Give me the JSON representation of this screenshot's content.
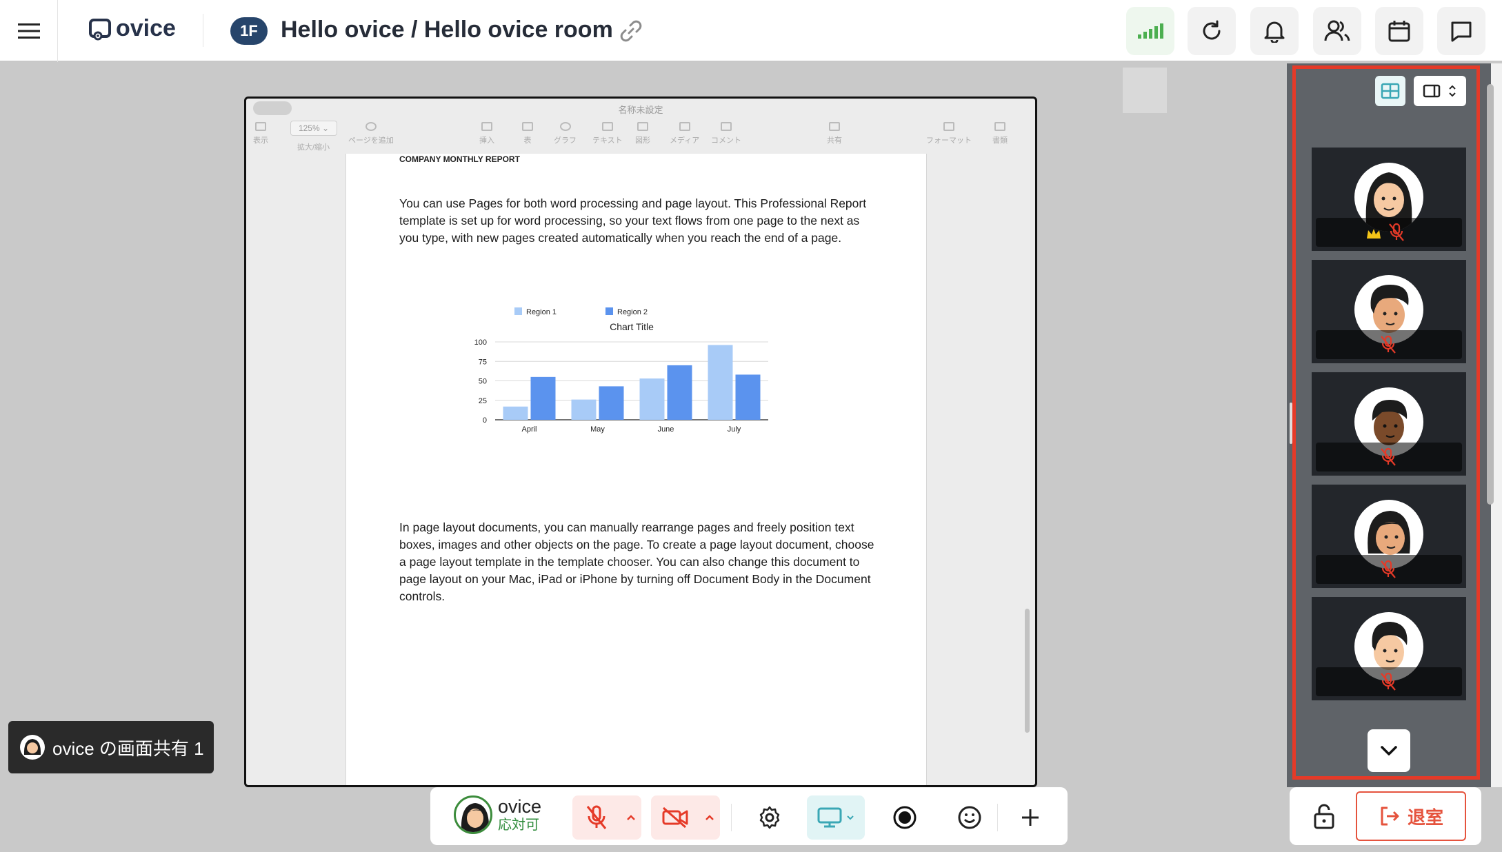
{
  "app": {
    "logo_text": "ovice",
    "floor_badge": "1F",
    "room_title": "Hello ovice / Hello ovice room"
  },
  "top_actions": [
    "signal-icon",
    "refresh-icon",
    "bell-icon",
    "users-icon",
    "calendar-icon",
    "chat-icon"
  ],
  "colors": {
    "accent_teal": "#3aa7b5",
    "alert_red": "#e53a28",
    "badge_navy": "#27456b",
    "signal_green": "#4caf50"
  },
  "shared_window": {
    "app_title": "名称未設定",
    "zoom": "125%",
    "toolbar": [
      {
        "label": "表示"
      },
      {
        "label": "拡大/縮小"
      },
      {
        "label": "ページを追加"
      },
      {
        "label": "挿入"
      },
      {
        "label": "表"
      },
      {
        "label": "グラフ"
      },
      {
        "label": "テキスト"
      },
      {
        "label": "図形"
      },
      {
        "label": "メディア"
      },
      {
        "label": "コメント"
      },
      {
        "label": "共有"
      },
      {
        "label": "フォーマット"
      },
      {
        "label": "書類"
      }
    ],
    "document": {
      "heading": "COMPANY MONTHLY REPORT",
      "para1": "You can use Pages for both word processing and page layout. This Professional Report template is set up for word processing, so your text flows from one page to the next as you type, with new pages created automatically when you reach the end of a page.",
      "para2": "In page layout documents, you can manually rearrange pages and freely position text boxes, images and other objects on the page. To create a page layout document, choose a page layout template in the template chooser. You can also change this document to page layout on your Mac, iPad or iPhone by turning off Document Body in the Document controls."
    }
  },
  "chart_data": {
    "type": "bar",
    "title": "Chart Title",
    "categories": [
      "April",
      "May",
      "June",
      "July"
    ],
    "series": [
      {
        "name": "Region 1",
        "values": [
          17,
          26,
          53,
          96
        ],
        "color": "#a8cbf7"
      },
      {
        "name": "Region 2",
        "values": [
          55,
          43,
          70,
          58
        ],
        "color": "#5b93ee"
      }
    ],
    "ylim": [
      0,
      100
    ],
    "yticks": [
      0,
      25,
      50,
      75,
      100
    ],
    "grid": true,
    "legend": "top"
  },
  "share_label": {
    "text": "ovice の画面共有 1"
  },
  "side_panel": {
    "participants": [
      {
        "avatar": "woman-long-hair",
        "host": true,
        "muted": true
      },
      {
        "avatar": "man-dark-hair",
        "host": false,
        "muted": true
      },
      {
        "avatar": "man-dark-skin",
        "host": false,
        "muted": true
      },
      {
        "avatar": "woman-bob",
        "host": false,
        "muted": true
      },
      {
        "avatar": "man-short-hair",
        "host": false,
        "muted": true
      }
    ]
  },
  "control_bar": {
    "user_name": "ovice",
    "user_status": "応対可"
  },
  "leave_button": {
    "label": "退室"
  }
}
